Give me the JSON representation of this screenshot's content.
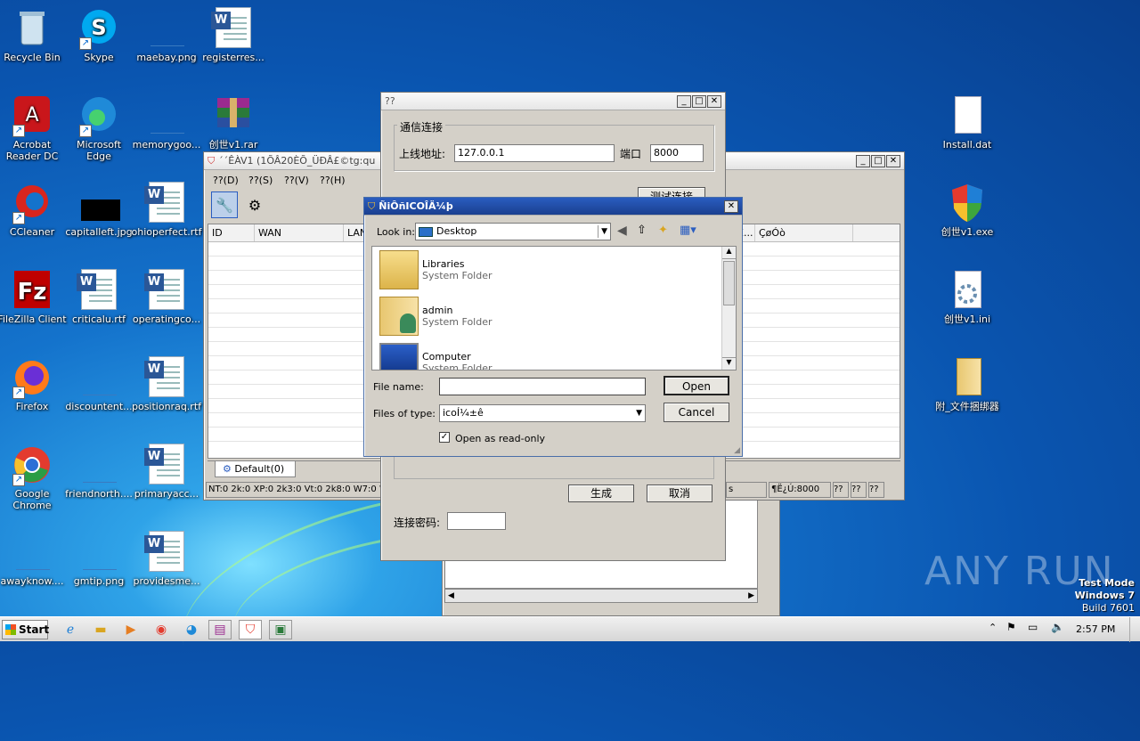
{
  "desktop": {
    "icons": [
      {
        "label": "Recycle Bin",
        "icon": "recycle-bin-icon"
      },
      {
        "label": "Skype",
        "icon": "skype-icon"
      },
      {
        "label": "maebay.png",
        "icon": "image-file-icon"
      },
      {
        "label": "registerres...",
        "icon": "word-doc-icon"
      },
      {
        "label": "Acrobat Reader DC",
        "icon": "acrobat-icon"
      },
      {
        "label": "Microsoft Edge",
        "icon": "edge-icon"
      },
      {
        "label": "memorygoo...",
        "icon": "image-file-icon"
      },
      {
        "label": "创世v1.rar",
        "icon": "winrar-icon"
      },
      {
        "label": "CCleaner",
        "icon": "ccleaner-icon"
      },
      {
        "label": "capitalleft.jpg",
        "icon": "image-file-icon"
      },
      {
        "label": "ohioperfect.rtf",
        "icon": "word-doc-icon"
      },
      {
        "label": "FileZilla Client",
        "icon": "filezilla-icon"
      },
      {
        "label": "criticalu.rtf",
        "icon": "word-doc-icon"
      },
      {
        "label": "operatingco...",
        "icon": "word-doc-icon"
      },
      {
        "label": "Firefox",
        "icon": "firefox-icon"
      },
      {
        "label": "discountent...",
        "icon": "image-file-icon"
      },
      {
        "label": "positionraq.rtf",
        "icon": "word-doc-icon"
      },
      {
        "label": "Google Chrome",
        "icon": "chrome-icon"
      },
      {
        "label": "friendnorth....",
        "icon": "image-file-icon"
      },
      {
        "label": "primaryacc...",
        "icon": "word-doc-icon"
      },
      {
        "label": "awayknow....",
        "icon": "image-file-icon"
      },
      {
        "label": "gmtip.png",
        "icon": "image-file-icon"
      },
      {
        "label": "providesme...",
        "icon": "word-doc-icon"
      },
      {
        "label": "Install.dat",
        "icon": "blank-file-icon"
      },
      {
        "label": "创世v1.exe",
        "icon": "shield-exe-icon"
      },
      {
        "label": "创世v1.ini",
        "icon": "ini-file-icon"
      },
      {
        "label": "附_文件捆绑器",
        "icon": "folder-icon"
      }
    ]
  },
  "main_window": {
    "title": "´´ÊÀV1 (1ÕÂ20ÈÕ_ÜÐÂ£©tg:qu",
    "menus": [
      "??(D)",
      "??(S)",
      "??(V)",
      "??(H)"
    ],
    "columns": [
      "ID",
      "WAN",
      "LAN",
      "Ê...",
      "ÇøÓò"
    ],
    "tab": "Default(0)",
    "status": [
      "NT:0 2k:0 XP:0 2k3:0 Vt:0 2k8:0 W7:0 W",
      "s",
      "¶Ë¿Ú:8000",
      "??",
      "??",
      "??"
    ]
  },
  "config_dialog": {
    "title": "??",
    "group_label": "通信连接",
    "address_label": "上线地址:",
    "address_value": "127.0.0.1",
    "port_label": "端口",
    "port_value": "8000",
    "test_button": "测试连接",
    "generate_button": "生成",
    "cancel_button": "取消",
    "password_label": "连接密码:",
    "password_value": ""
  },
  "file_dialog": {
    "title": "ÑiÔñICOÎÄ¼þ",
    "look_in_label": "Look in:",
    "look_in_value": "Desktop",
    "items": [
      {
        "name": "Libraries",
        "type": "System Folder",
        "icon": "libraries-folder-icon"
      },
      {
        "name": "admin",
        "type": "System Folder",
        "icon": "user-folder-icon"
      },
      {
        "name": "Computer",
        "type": "System Folder",
        "icon": "computer-icon"
      }
    ],
    "file_name_label": "File name:",
    "file_name_value": "",
    "file_type_label": "Files of type:",
    "file_type_value": "icoÍ¼±ê",
    "readonly_label": "Open as read-only",
    "open_button": "Open",
    "cancel_button": "Cancel"
  },
  "taskbar": {
    "start": "Start",
    "time": "2:57 PM"
  },
  "watermark": {
    "brand": "ANY RUN",
    "line1": "Test Mode",
    "line2": "Windows 7",
    "line3": "Build 7601"
  }
}
